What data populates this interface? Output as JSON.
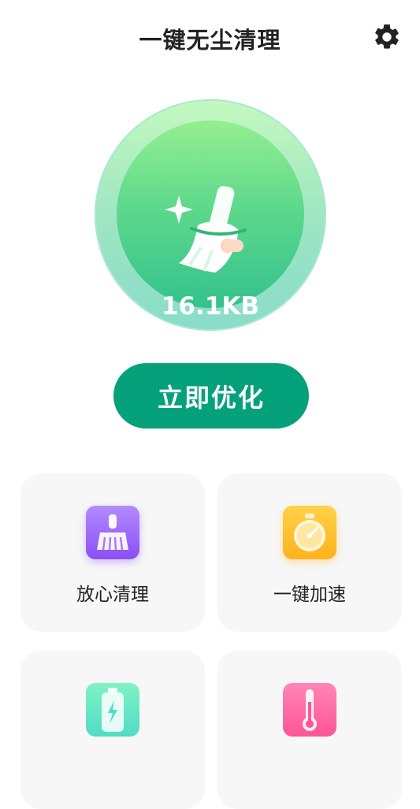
{
  "header": {
    "title": "一键无尘清理",
    "settings_icon": "gear-icon"
  },
  "hero": {
    "size_text": "16.1KB",
    "icon": "broom-sparkle-icon",
    "colors": {
      "outer": "#a8ecc7",
      "inner": "#4fd08d"
    }
  },
  "cta": {
    "label": "立即优化",
    "color": "#05a17b"
  },
  "features": [
    {
      "label": "放心清理",
      "icon": "broom-icon",
      "color": "#8a4ff5"
    },
    {
      "label": "一键加速",
      "icon": "stopwatch-icon",
      "color": "#ffb21b"
    },
    {
      "label": "",
      "icon": "battery-icon",
      "color": "#4fdcc5"
    },
    {
      "label": "",
      "icon": "thermometer-icon",
      "color": "#ff5596"
    }
  ]
}
